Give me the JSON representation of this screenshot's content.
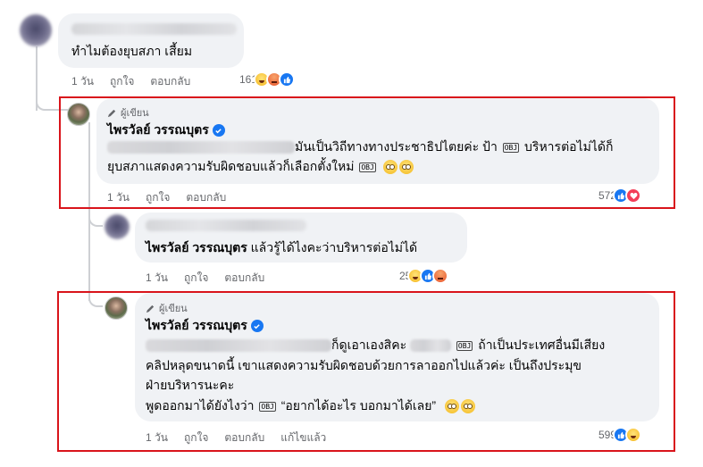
{
  "comments": [
    {
      "id": "c1",
      "text": "ทำไมต้องยุบสภา เสี้ยม",
      "time": "1 วัน",
      "like": "ถูกใจ",
      "reply": "ตอบกลับ",
      "reaction_count": "161",
      "reactions": [
        "haha-icon",
        "angry-icon",
        "like-icon"
      ]
    },
    {
      "id": "c2",
      "author_tag": "ผู้เขียน",
      "author_name": "ไพรวัลย์ วรรณบุตร",
      "text_line1": "มันเป็นวิถีทางทางประชาธิปไตยค่ะ ป้า",
      "text_line1b": "บริหารต่อไม่ได้ก็",
      "text_line2": "ยุบสภาแสดงความรับผิดชอบแล้วก็เลือกตั้งใหม่",
      "time": "1 วัน",
      "like": "ถูกใจ",
      "reply": "ตอบกลับ",
      "reaction_count": "572",
      "reactions": [
        "like-icon",
        "love-icon"
      ]
    },
    {
      "id": "c3",
      "mention": "ไพรวัลย์ วรรณบุตร",
      "text": "แล้วรู้ได้ไงคะว่าบริหารต่อไม่ได้",
      "time": "1 วัน",
      "like": "ถูกใจ",
      "reply": "ตอบกลับ",
      "reaction_count": "25",
      "reactions": [
        "haha-icon",
        "like-icon",
        "angry-icon"
      ]
    },
    {
      "id": "c4",
      "author_tag": "ผู้เขียน",
      "author_name": "ไพรวัลย์ วรรณบุตร",
      "text_line1a": "ก็ดูเอาเองสิคะ",
      "text_line1b": "ถ้าเป็นประเทศอื่นมีเสียง",
      "text_line2": "คลิปหลุดขนาดนี้ เขาแสดงความรับผิดชอบด้วยการลาออกไปแล้วค่ะ เป็นถึงประมุข",
      "text_line3": "ฝ่ายบริหารนะคะ",
      "text_line4a": "พูดออกมาได้ยังไงว่า",
      "text_line4b": "“อยากได้อะไร บอกมาได้เลย”",
      "time": "1 วัน",
      "like": "ถูกใจ",
      "reply": "ตอบกลับ",
      "edited": "แก้ไขแล้ว",
      "reaction_count": "599",
      "reactions": [
        "like-icon",
        "haha-icon"
      ]
    }
  ],
  "obj_glyph": "OBJ",
  "colors": {
    "bubble": "#f0f2f5",
    "secondary_text": "#65676b",
    "verified": "#1877f2",
    "highlight": "#d9141b"
  }
}
